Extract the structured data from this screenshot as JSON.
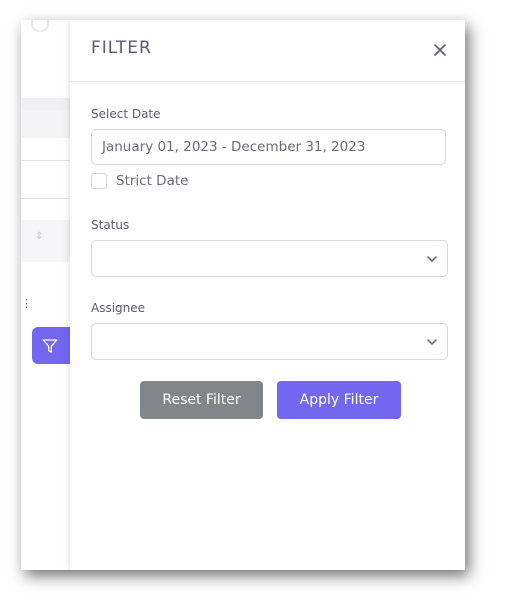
{
  "panel": {
    "title": "FILTER",
    "close_icon": "close-icon"
  },
  "date_filter": {
    "label": "Select Date",
    "value": "January 01, 2023 - December 31, 2023",
    "strict_label": "Strict Date",
    "strict_checked": false
  },
  "status_filter": {
    "label": "Status",
    "value": ""
  },
  "assignee_filter": {
    "label": "Assignee",
    "value": ""
  },
  "actions": {
    "reset_label": "Reset Filter",
    "apply_label": "Apply Filter"
  },
  "background": {
    "filter_button_icon": "filter-icon"
  },
  "colors": {
    "primary": "#7367f0",
    "secondary": "#82868b",
    "text": "#5e5873",
    "border": "#d8d6de"
  }
}
